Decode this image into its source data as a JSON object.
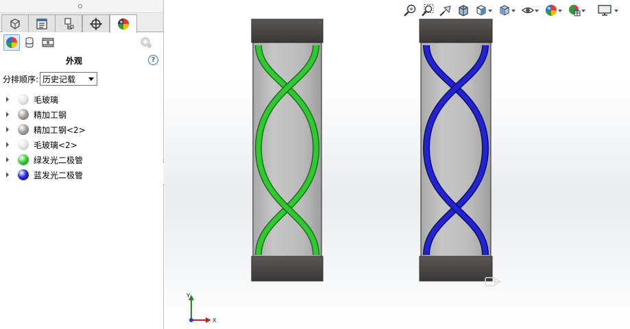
{
  "panel": {
    "title": "外观",
    "help_glyph": "?",
    "sort_label": "分排顺序:",
    "sort_value": "历史记载",
    "tabs": [
      {
        "name": "feature-manager",
        "icon": "feature-tree-icon"
      },
      {
        "name": "property-manager",
        "icon": "property-list-icon"
      },
      {
        "name": "configuration-manager",
        "icon": "configuration-icon"
      },
      {
        "name": "dimxpert-manager",
        "icon": "crosshair-icon"
      },
      {
        "name": "display-manager",
        "icon": "appearance-ball-icon",
        "active": true
      }
    ],
    "subtools": [
      {
        "name": "appearances",
        "icon": "color-ball-icon",
        "active": true
      },
      {
        "name": "decals",
        "icon": "decal-icon"
      },
      {
        "name": "scenes",
        "icon": "scene-icon"
      }
    ],
    "materials": [
      {
        "label": "毛玻璃",
        "color": "#e8e8e8",
        "shade": "#b5b5b5"
      },
      {
        "label": "精加工钢",
        "color": "#a9a39e",
        "shade": "#5f5955"
      },
      {
        "label": "精加工钢<2>",
        "color": "#a9a39e",
        "shade": "#5f5955"
      },
      {
        "label": "毛玻璃<2>",
        "color": "#e8e8e8",
        "shade": "#b5b5b5"
      },
      {
        "label": "绿发光二极管",
        "color": "#3cd23c",
        "shade": "#0a7a0a"
      },
      {
        "label": "蓝发光二极管",
        "color": "#2a2ae0",
        "shade": "#050570"
      }
    ]
  },
  "view_toolbar": {
    "icons": [
      "zoom-to-fit-icon",
      "zoom-to-area-icon",
      "previous-view-icon",
      "section-view-icon",
      "view-orientation-icon",
      "display-style-icon",
      "hide-show-icon",
      "edit-appearance-icon",
      "apply-scene-icon",
      "view-settings-icon"
    ]
  },
  "scene": {
    "cap_color": "#484543",
    "body_color": "#b9b9b9",
    "left_helix_color": "#2fc82f",
    "right_helix_color": "#2323cf"
  },
  "triad": {
    "y_label": "Y",
    "x_label": "X"
  }
}
